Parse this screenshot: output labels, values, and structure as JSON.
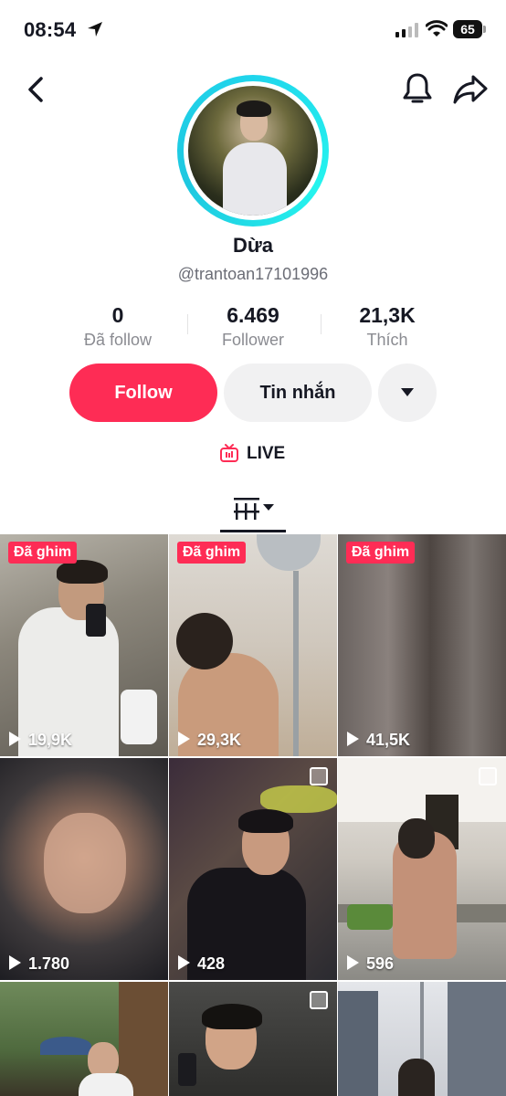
{
  "status_bar": {
    "time": "08:54",
    "battery": "65"
  },
  "profile": {
    "name": "Dừa",
    "handle": "@trantoan17101996",
    "stats": [
      {
        "value": "0",
        "label": "Đã follow"
      },
      {
        "value": "6.469",
        "label": "Follower"
      },
      {
        "value": "21,3K",
        "label": "Thích"
      }
    ]
  },
  "actions": {
    "follow": "Follow",
    "message": "Tin nhắn"
  },
  "live_label": "LIVE",
  "videos": [
    {
      "pinned_label": "Đã ghim",
      "views": "19,9K"
    },
    {
      "pinned_label": "Đã ghim",
      "views": "29,3K"
    },
    {
      "pinned_label": "Đã ghim",
      "views": "41,5K"
    },
    {
      "views": "1.780"
    },
    {
      "views": "428"
    },
    {
      "views": "596"
    },
    {
      "views": ""
    },
    {
      "views": ""
    },
    {
      "views": ""
    }
  ],
  "colors": {
    "accent": "#fe2c55",
    "ring": "#20d5ec"
  }
}
